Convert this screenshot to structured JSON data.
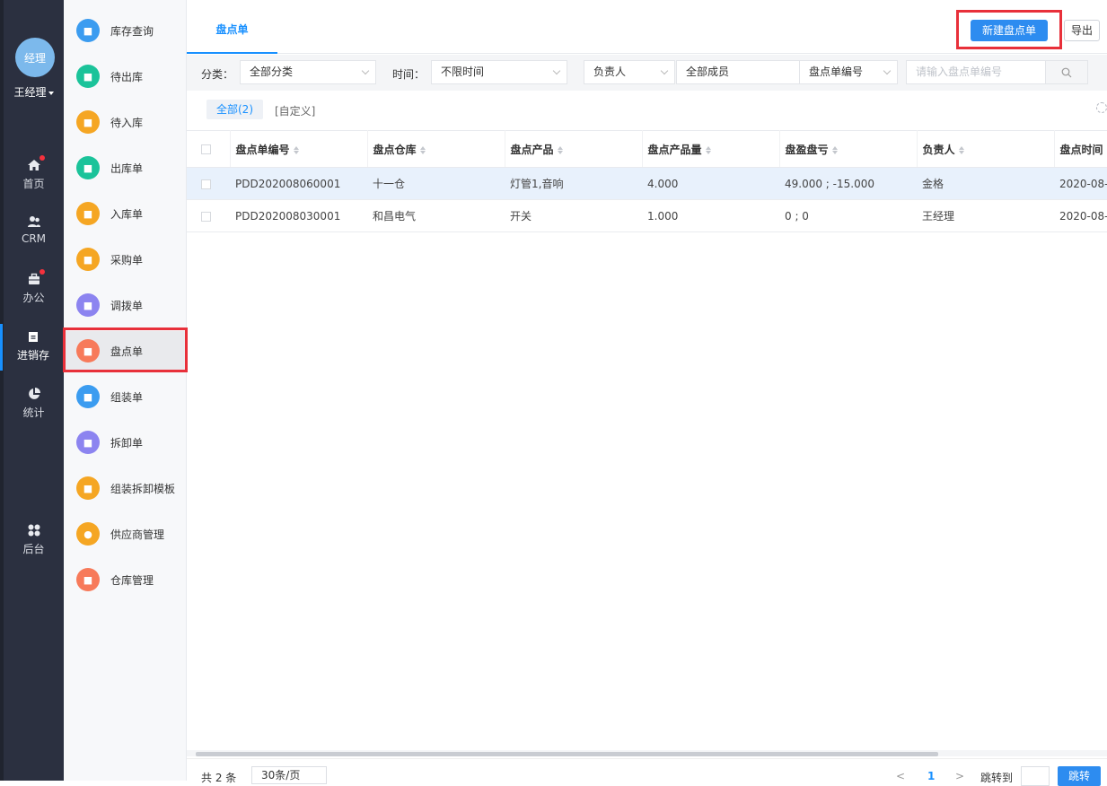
{
  "nav": {
    "avatar_text": "经理",
    "user_name": "王经理",
    "items": [
      {
        "label": "首页",
        "icon": "home-icon",
        "badge": true
      },
      {
        "label": "CRM",
        "icon": "users-icon",
        "badge": false
      },
      {
        "label": "办公",
        "icon": "briefcase-icon",
        "badge": true
      },
      {
        "label": "进销存",
        "icon": "inventory-icon",
        "badge": false,
        "active": true
      },
      {
        "label": "统计",
        "icon": "pie-chart-icon",
        "badge": false
      },
      {
        "label": "后台",
        "icon": "grid-icon",
        "badge": false
      }
    ]
  },
  "submenu": {
    "items": [
      {
        "label": "库存查询",
        "color": "#3b9cf0"
      },
      {
        "label": "待出库",
        "color": "#1bc39a"
      },
      {
        "label": "待入库",
        "color": "#f5a623"
      },
      {
        "label": "出库单",
        "color": "#1bc39a"
      },
      {
        "label": "入库单",
        "color": "#f5a623"
      },
      {
        "label": "采购单",
        "color": "#f5a623"
      },
      {
        "label": "调拨单",
        "color": "#8c84f0"
      },
      {
        "label": "盘点单",
        "color": "#f77a5a",
        "active": true
      },
      {
        "label": "组装单",
        "color": "#3b9cf0"
      },
      {
        "label": "拆卸单",
        "color": "#8c84f0"
      },
      {
        "label": "组装拆卸模板",
        "color": "#f5a623"
      },
      {
        "label": "供应商管理",
        "color": "#f5a623"
      },
      {
        "label": "仓库管理",
        "color": "#f77a5a"
      }
    ]
  },
  "header": {
    "tab": "盘点单",
    "new_button": "新建盘点单",
    "export_button": "导出"
  },
  "filters": {
    "category_label": "分类：",
    "category_value": "全部分类",
    "time_label": "时间：",
    "time_value": "不限时间",
    "owner_value": "负责人",
    "member_value": "全部成员",
    "field_value": "盘点单编号",
    "search_placeholder": "请输入盘点单编号"
  },
  "views": {
    "all": "全部(2)",
    "custom": "[自定义]"
  },
  "table": {
    "columns": [
      "盘点单编号",
      "盘点仓库",
      "盘点产品",
      "盘点产品量",
      "盘盈盘亏",
      "负责人",
      "盘点时间"
    ],
    "rows": [
      [
        "PDD202008060001",
        "十一仓",
        "灯管1,音响",
        "4.000",
        "49.000 ; -15.000",
        "金格",
        "2020-08-"
      ],
      [
        "PDD202008030001",
        "和昌电气",
        "开关",
        "1.000",
        "0 ; 0",
        "王经理",
        "2020-08-"
      ]
    ]
  },
  "footer": {
    "total": "共 2 条",
    "page_size": "30条/页",
    "current_page": "1",
    "jump_label": "跳转到",
    "jump_button": "跳转"
  },
  "colors": {
    "primary": "#2d8cf0",
    "highlight": "#e8303a"
  }
}
